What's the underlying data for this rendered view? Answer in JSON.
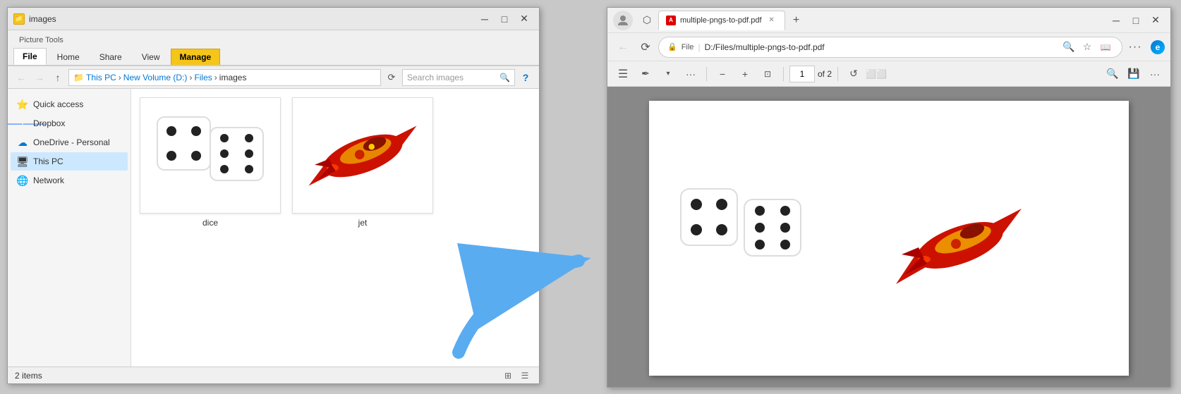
{
  "explorer": {
    "title": "images",
    "title_bar": {
      "folder_label": "images",
      "minimize": "─",
      "maximize": "□",
      "close": "✕"
    },
    "ribbon": {
      "tabs": [
        {
          "id": "file",
          "label": "File",
          "active": true
        },
        {
          "id": "home",
          "label": "Home",
          "active": false
        },
        {
          "id": "share",
          "label": "Share",
          "active": false
        },
        {
          "id": "view",
          "label": "View",
          "active": false
        },
        {
          "id": "manage",
          "label": "Manage",
          "active": false,
          "highlight": true
        },
        {
          "id": "picture-tools",
          "label": "Picture Tools",
          "extra": true
        }
      ]
    },
    "breadcrumb": {
      "path": "This PC > New Volume (D:) > Files > images",
      "parts": [
        "This PC",
        "New Volume (D:)",
        "Files",
        "images"
      ]
    },
    "search": {
      "placeholder": "Search images"
    },
    "sidebar": {
      "items": [
        {
          "id": "quick-access",
          "label": "Quick access",
          "icon": "⭐"
        },
        {
          "id": "dropbox",
          "label": "Dropbox",
          "icon": "📦"
        },
        {
          "id": "onedrive",
          "label": "OneDrive - Personal",
          "icon": "☁"
        },
        {
          "id": "this-pc",
          "label": "This PC",
          "icon": "💻",
          "active": true
        },
        {
          "id": "network",
          "label": "Network",
          "icon": "🌐"
        }
      ]
    },
    "files": [
      {
        "id": "dice",
        "name": "dice",
        "type": "image"
      },
      {
        "id": "jet",
        "name": "jet",
        "type": "image"
      }
    ],
    "status": {
      "count": "2",
      "label": "items"
    }
  },
  "browser": {
    "title_bar": {
      "tab_title": "multiple-pngs-to-pdf.pdf",
      "minimize": "─",
      "maximize": "□",
      "close": "✕"
    },
    "address_bar": {
      "protocol": "File",
      "path": "D:/Files/multiple-pngs-to-pdf.pdf"
    },
    "pdf_toolbar": {
      "current_page": "1",
      "total_pages": "of 2"
    }
  }
}
